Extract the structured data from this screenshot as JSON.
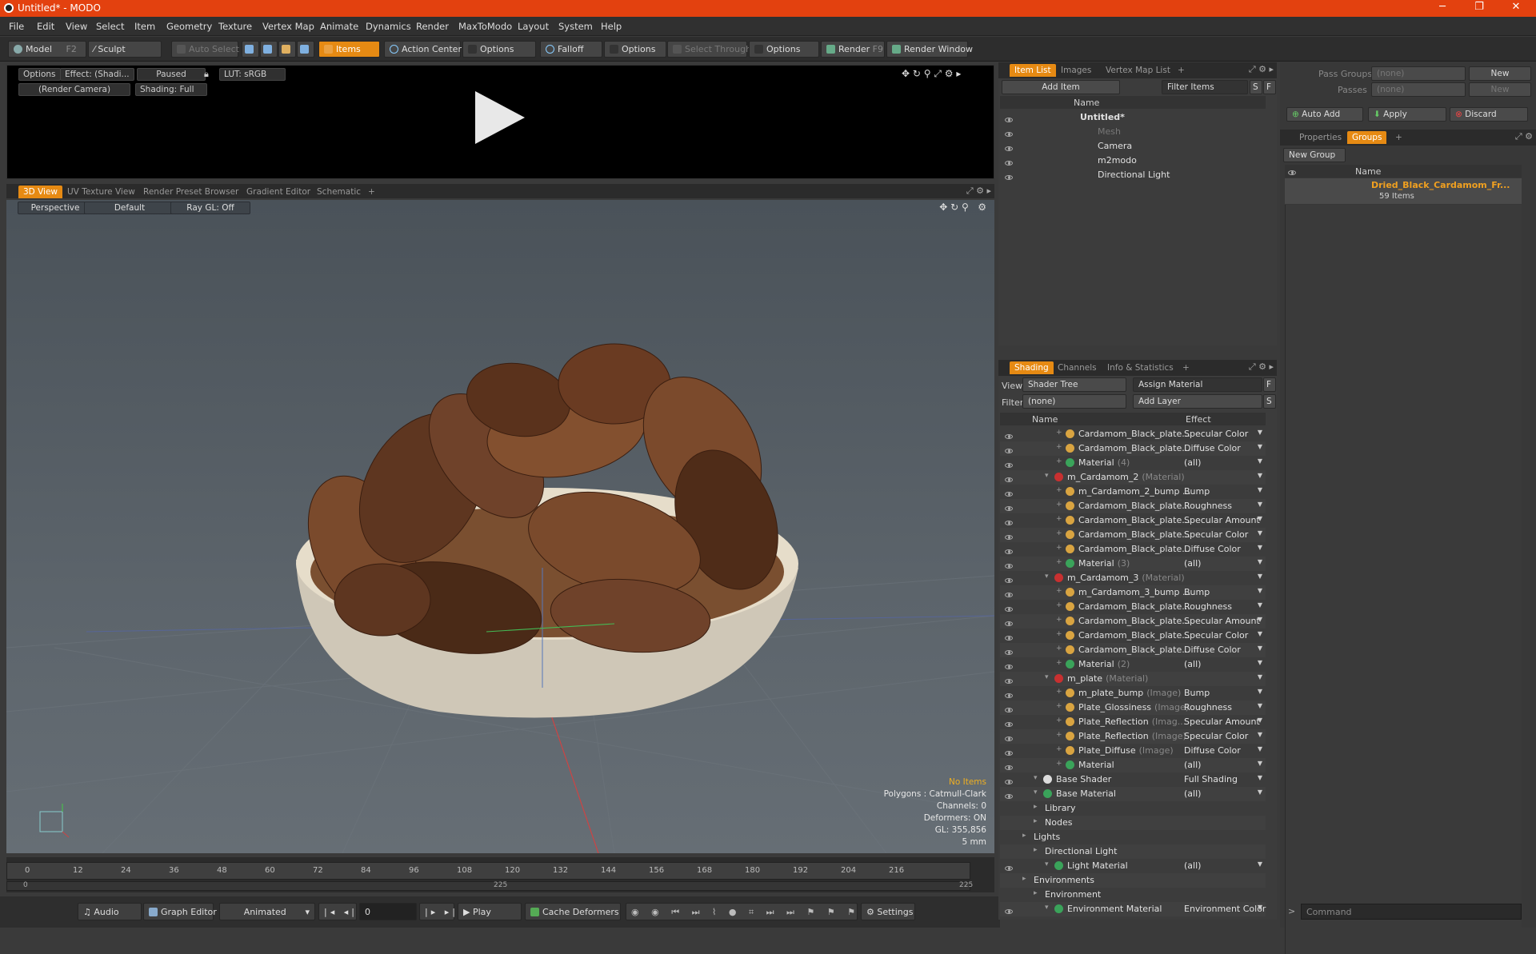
{
  "window": {
    "title": "Untitled* - MODO"
  },
  "menu": [
    "File",
    "Edit",
    "View",
    "Select",
    "Item",
    "Geometry",
    "Texture",
    "Vertex Map",
    "Animate",
    "Dynamics",
    "Render",
    "MaxToModo",
    "Layout",
    "System",
    "Help"
  ],
  "toolbar": {
    "model": "Model",
    "model_key": "F2",
    "sculpt": "Sculpt",
    "auto_select": "Auto Select",
    "items": "Items",
    "action_center": "Action Center",
    "options1": "Options",
    "falloff": "Falloff",
    "options2": "Options",
    "select_through": "Select Through",
    "options3": "Options",
    "render": "Render",
    "render_key": "F9",
    "render_window": "Render Window",
    "accent": "#e68a13"
  },
  "preview": {
    "options": "Options",
    "effect": "Effect: (Shadi...",
    "paused": "Paused",
    "lut": "LUT: sRGB",
    "camera": "(Render Camera)",
    "shading": "Shading: Full"
  },
  "view_tabs": [
    "3D View",
    "UV Texture View",
    "Render Preset Browser",
    "Gradient Editor",
    "Schematic",
    "+"
  ],
  "viewport": {
    "perspective": "Perspective",
    "default": "Default",
    "raygl": "Ray GL: Off",
    "info": {
      "no_items": "No Items",
      "polygons": "Polygons : Catmull-Clark",
      "channels": "Channels: 0",
      "deformers": "Deformers: ON",
      "gl": "GL: 355,856",
      "scale": "5 mm"
    }
  },
  "timeline": {
    "ticks": [
      "0",
      "12",
      "24",
      "36",
      "48",
      "60",
      "72",
      "84",
      "96",
      "108",
      "120",
      "132",
      "144",
      "156",
      "168",
      "180",
      "192",
      "204",
      "216"
    ],
    "range_start": "0",
    "range_mid": "225",
    "range_end": "225"
  },
  "bottom": {
    "audio": "Audio",
    "graph_editor": "Graph Editor",
    "animated": "Animated",
    "frame": "0",
    "play": "Play",
    "cache_deformers": "Cache Deformers",
    "settings": "Settings"
  },
  "item_list": {
    "tabs": [
      "Item List",
      "Images",
      "Vertex Map List",
      "+"
    ],
    "add_item": "Add Item",
    "filter_items": "Filter Items",
    "s": "S",
    "f": "F",
    "col_name": "Name",
    "items": [
      {
        "label": "Untitled*",
        "indent": 0,
        "bold": true
      },
      {
        "label": "Mesh",
        "indent": 1,
        "gray": true
      },
      {
        "label": "Camera",
        "indent": 1
      },
      {
        "label": "m2modo",
        "indent": 1
      },
      {
        "label": "Directional Light",
        "indent": 1
      }
    ]
  },
  "shading": {
    "tabs": [
      "Shading",
      "Channels",
      "Info & Statistics",
      "+"
    ],
    "view_label": "View",
    "view_value": "Shader Tree",
    "assign_material": "Assign Material",
    "f": "F",
    "filter_label": "Filter",
    "filter_value": "(none)",
    "add_layer": "Add Layer",
    "s": "S",
    "col_name": "Name",
    "col_effect": "Effect",
    "rows": [
      {
        "name": "Cardamom_Black_plate...",
        "tag": "",
        "effect": "Specular Color",
        "indent": 3,
        "color": "#d9a441"
      },
      {
        "name": "Cardamom_Black_plate...",
        "tag": "",
        "effect": "Diffuse Color",
        "indent": 3,
        "color": "#d9a441"
      },
      {
        "name": "Material",
        "tag": "(4)",
        "effect": "(all)",
        "indent": 3,
        "color": "#3aa35a"
      },
      {
        "name": "m_Cardamom_2",
        "tag": "(Material)",
        "effect": "",
        "indent": 2,
        "color": "#c83030"
      },
      {
        "name": "m_Cardamom_2_bump ...",
        "tag": "",
        "effect": "Bump",
        "indent": 3,
        "color": "#d9a441"
      },
      {
        "name": "Cardamom_Black_plate...",
        "tag": "",
        "effect": "Roughness",
        "indent": 3,
        "color": "#d9a441"
      },
      {
        "name": "Cardamom_Black_plate...",
        "tag": "",
        "effect": "Specular Amount",
        "indent": 3,
        "color": "#d9a441"
      },
      {
        "name": "Cardamom_Black_plate...",
        "tag": "",
        "effect": "Specular Color",
        "indent": 3,
        "color": "#d9a441"
      },
      {
        "name": "Cardamom_Black_plate...",
        "tag": "",
        "effect": "Diffuse Color",
        "indent": 3,
        "color": "#d9a441"
      },
      {
        "name": "Material",
        "tag": "(3)",
        "effect": "(all)",
        "indent": 3,
        "color": "#3aa35a"
      },
      {
        "name": "m_Cardamom_3",
        "tag": "(Material)",
        "effect": "",
        "indent": 2,
        "color": "#c83030"
      },
      {
        "name": "m_Cardamom_3_bump ...",
        "tag": "",
        "effect": "Bump",
        "indent": 3,
        "color": "#d9a441"
      },
      {
        "name": "Cardamom_Black_plate...",
        "tag": "",
        "effect": "Roughness",
        "indent": 3,
        "color": "#d9a441"
      },
      {
        "name": "Cardamom_Black_plate...",
        "tag": "",
        "effect": "Specular Amount",
        "indent": 3,
        "color": "#d9a441"
      },
      {
        "name": "Cardamom_Black_plate...",
        "tag": "",
        "effect": "Specular Color",
        "indent": 3,
        "color": "#d9a441"
      },
      {
        "name": "Cardamom_Black_plate...",
        "tag": "",
        "effect": "Diffuse Color",
        "indent": 3,
        "color": "#d9a441"
      },
      {
        "name": "Material",
        "tag": "(2)",
        "effect": "(all)",
        "indent": 3,
        "color": "#3aa35a"
      },
      {
        "name": "m_plate",
        "tag": "(Material)",
        "effect": "",
        "indent": 2,
        "color": "#c83030"
      },
      {
        "name": "m_plate_bump",
        "tag": "(Image)",
        "effect": "Bump",
        "indent": 3,
        "color": "#d9a441"
      },
      {
        "name": "Plate_Glossiness",
        "tag": "(Image)",
        "effect": "Roughness",
        "indent": 3,
        "color": "#d9a441"
      },
      {
        "name": "Plate_Reflection",
        "tag": "(Imag...",
        "effect": "Specular Amount",
        "indent": 3,
        "color": "#d9a441"
      },
      {
        "name": "Plate_Reflection",
        "tag": "(Image)",
        "effect": "Specular Color",
        "indent": 3,
        "color": "#d9a441"
      },
      {
        "name": "Plate_Diffuse",
        "tag": "(Image)",
        "effect": "Diffuse Color",
        "indent": 3,
        "color": "#d9a441"
      },
      {
        "name": "Material",
        "tag": "",
        "effect": "(all)",
        "indent": 3,
        "color": "#3aa35a"
      },
      {
        "name": "Base Shader",
        "tag": "",
        "effect": "Full Shading",
        "indent": 1,
        "color": "#dddddd"
      },
      {
        "name": "Base Material",
        "tag": "",
        "effect": "(all)",
        "indent": 1,
        "color": "#3aa35a"
      },
      {
        "name": "Library",
        "tag": "",
        "effect": "",
        "indent": 1,
        "color": ""
      },
      {
        "name": "Nodes",
        "tag": "",
        "effect": "",
        "indent": 1,
        "color": ""
      },
      {
        "name": "Lights",
        "tag": "",
        "effect": "",
        "indent": 0,
        "color": ""
      },
      {
        "name": "Directional Light",
        "tag": "",
        "effect": "",
        "indent": 1,
        "color": ""
      },
      {
        "name": "Light Material",
        "tag": "",
        "effect": "(all)",
        "indent": 2,
        "color": "#3aa35a"
      },
      {
        "name": "Environments",
        "tag": "",
        "effect": "",
        "indent": 0,
        "color": ""
      },
      {
        "name": "Environment",
        "tag": "",
        "effect": "",
        "indent": 1,
        "color": ""
      },
      {
        "name": "Environment Material",
        "tag": "",
        "effect": "Environment Color",
        "indent": 2,
        "color": "#3aa35a"
      }
    ]
  },
  "right_panel": {
    "pass_groups_label": "Pass Groups",
    "pass_groups_value": "(none)",
    "new1": "New",
    "passes_label": "Passes",
    "passes_value": "(none)",
    "new2": "New",
    "auto_add": "Auto Add",
    "apply": "Apply",
    "discard": "Discard",
    "tabs": [
      "Properties",
      "Groups",
      "+"
    ],
    "new_group": "New Group",
    "col_name": "Name",
    "group_name": "Dried_Black_Cardamom_Fr...",
    "group_items": "59 Items",
    "command_placeholder": "Command"
  }
}
